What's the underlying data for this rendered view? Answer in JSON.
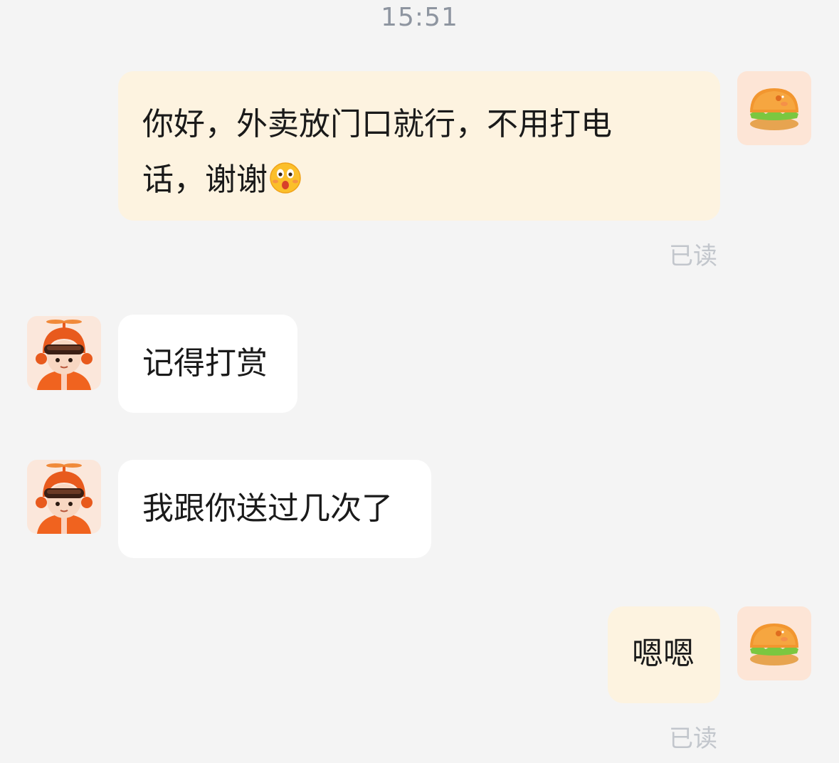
{
  "chat": {
    "timestamp": "15:51",
    "messages": [
      {
        "sender": "me",
        "avatar_icon": "burger-icon",
        "line1": "你好，外卖放门口就行，不用打电",
        "line2": "话，谢谢",
        "emoji_icon": "surprised-face-icon",
        "status": "已读"
      },
      {
        "sender": "rider",
        "avatar_icon": "delivery-rider-icon",
        "text": "记得打赏"
      },
      {
        "sender": "rider",
        "avatar_icon": "delivery-rider-icon",
        "text": "我跟你送过几次了"
      },
      {
        "sender": "me",
        "avatar_icon": "burger-icon",
        "text": "嗯嗯",
        "status": "已读"
      }
    ]
  },
  "colors": {
    "background": "#f4f4f4",
    "my_bubble": "#fdf3e0",
    "other_bubble": "#ffffff",
    "timestamp_text": "#8e95a0",
    "read_status": "#c2c6cc",
    "rider_orange": "#f0631f"
  }
}
